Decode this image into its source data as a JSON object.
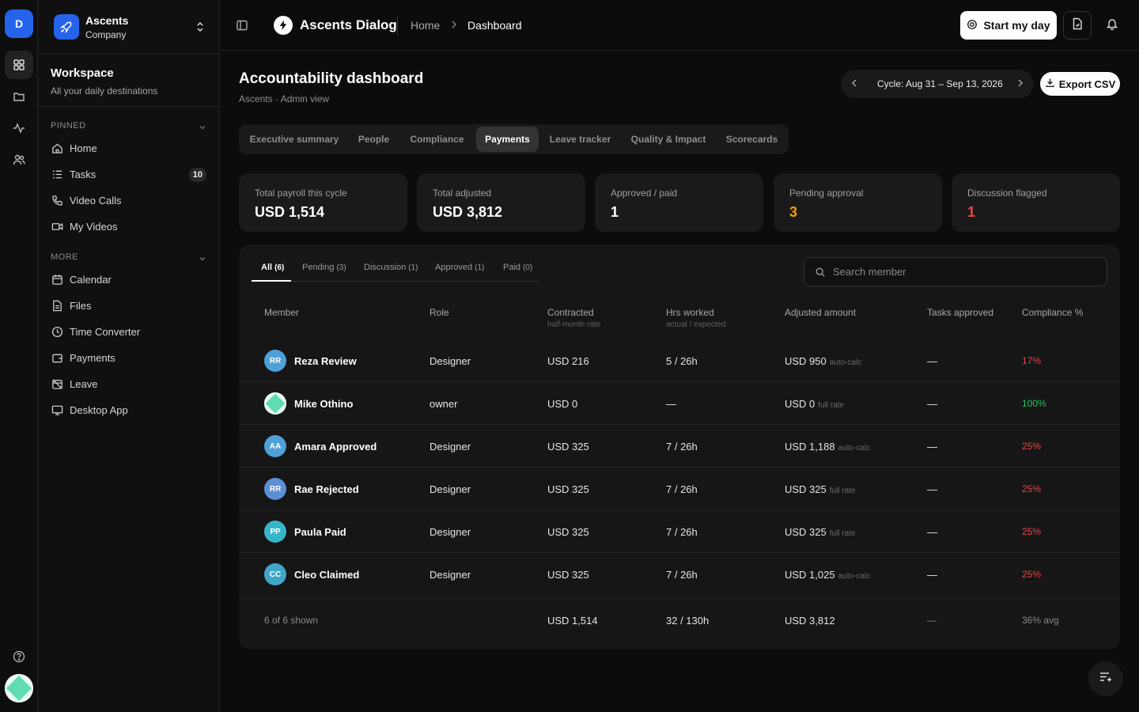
{
  "rail": {
    "workspace_initial": "D"
  },
  "sidebar": {
    "company_name": "Ascents",
    "company_sub": "Company",
    "workspace_title": "Workspace",
    "workspace_sub": "All your daily destinations",
    "pinned_label": "PINNED",
    "pinned": [
      {
        "label": "Home",
        "icon": "home-icon"
      },
      {
        "label": "Tasks",
        "icon": "tasks-icon",
        "count": "10"
      },
      {
        "label": "Video Calls",
        "icon": "phone-icon"
      },
      {
        "label": "My Videos",
        "icon": "video-icon"
      }
    ],
    "more_label": "MORE",
    "more": [
      {
        "label": "Calendar",
        "icon": "calendar-icon"
      },
      {
        "label": "Files",
        "icon": "file-icon"
      },
      {
        "label": "Time Converter",
        "icon": "clock-icon"
      },
      {
        "label": "Payments",
        "icon": "wallet-icon"
      },
      {
        "label": "Leave",
        "icon": "calendar-off-icon"
      },
      {
        "label": "Desktop App",
        "icon": "monitor-icon"
      }
    ]
  },
  "topbar": {
    "brand": "Ascents Dialog",
    "breadcrumb": [
      "Home",
      "Dashboard"
    ],
    "start_day": "Start my day"
  },
  "page": {
    "title": "Accountability dashboard",
    "subtitle": "Ascents · Admin view",
    "cycle": "Cycle: Aug 31 – Sep 13, 2026",
    "export": "Export CSV",
    "tabs": [
      "Executive summary",
      "People",
      "Compliance",
      "Payments",
      "Leave tracker",
      "Quality & Impact",
      "Scorecards"
    ],
    "active_tab": "Payments"
  },
  "stats": [
    {
      "label": "Total payroll this cycle",
      "value": "USD 1,514",
      "color": "#ffffff"
    },
    {
      "label": "Total adjusted",
      "value": "USD 3,812",
      "color": "#ffffff"
    },
    {
      "label": "Approved / paid",
      "value": "1",
      "color": "#ffffff"
    },
    {
      "label": "Pending approval",
      "value": "3",
      "color": "#f59e0b"
    },
    {
      "label": "Discussion flagged",
      "value": "1",
      "color": "#ef4444"
    }
  ],
  "filters": [
    {
      "label": "All",
      "count": "(6)"
    },
    {
      "label": "Pending",
      "count": "(3)"
    },
    {
      "label": "Discussion",
      "count": "(1)"
    },
    {
      "label": "Approved",
      "count": "(1)"
    },
    {
      "label": "Paid",
      "count": "(0)"
    }
  ],
  "search_placeholder": "Search member",
  "columns": {
    "member": "Member",
    "role": "Role",
    "contracted": "Contracted",
    "contracted_sub": "half-month rate",
    "hrs": "Hrs worked",
    "hrs_sub": "actual / expected",
    "adjusted": "Adjusted amount",
    "tasks": "Tasks approved",
    "compliance": "Compliance %"
  },
  "rows": [
    {
      "initials": "RR",
      "name": "Reza Review",
      "role": "Designer",
      "contracted": "USD 216",
      "hrs": "5 / 26h",
      "adjusted": "USD 950",
      "adjusted_tag": "auto-calc",
      "tasks": "—",
      "compliance": "17%",
      "good": false,
      "avatar_color": "#4ea0d8"
    },
    {
      "initials": "",
      "name": "Mike Othino",
      "role": "owner",
      "contracted": "USD 0",
      "hrs": "—",
      "adjusted": "USD 0",
      "adjusted_tag": "full rate",
      "tasks": "—",
      "compliance": "100%",
      "good": true,
      "avatar_color": "pattern"
    },
    {
      "initials": "AA",
      "name": "Amara Approved",
      "role": "Designer",
      "contracted": "USD 325",
      "hrs": "7 / 26h",
      "adjusted": "USD 1,188",
      "adjusted_tag": "auto-calc",
      "tasks": "—",
      "compliance": "25%",
      "good": false,
      "avatar_color": "#4ea0d8"
    },
    {
      "initials": "RR",
      "name": "Rae Rejected",
      "role": "Designer",
      "contracted": "USD 325",
      "hrs": "7 / 26h",
      "adjusted": "USD 325",
      "adjusted_tag": "full rate",
      "tasks": "—",
      "compliance": "25%",
      "good": false,
      "avatar_color": "#5b8fd6"
    },
    {
      "initials": "PP",
      "name": "Paula Paid",
      "role": "Designer",
      "contracted": "USD 325",
      "hrs": "7 / 26h",
      "adjusted": "USD 325",
      "adjusted_tag": "full rate",
      "tasks": "—",
      "compliance": "25%",
      "good": false,
      "avatar_color": "#38b6c9"
    },
    {
      "initials": "CC",
      "name": "Cleo Claimed",
      "role": "Designer",
      "contracted": "USD 325",
      "hrs": "7 / 26h",
      "adjusted": "USD 1,025",
      "adjusted_tag": "auto-calc",
      "tasks": "—",
      "compliance": "25%",
      "good": false,
      "avatar_color": "#3fa6c9"
    }
  ],
  "footer": {
    "shown": "6 of 6 shown",
    "contracted": "USD 1,514",
    "hrs": "32 / 130h",
    "adjusted": "USD 3,812",
    "tasks": "—",
    "compliance": "36% avg"
  }
}
